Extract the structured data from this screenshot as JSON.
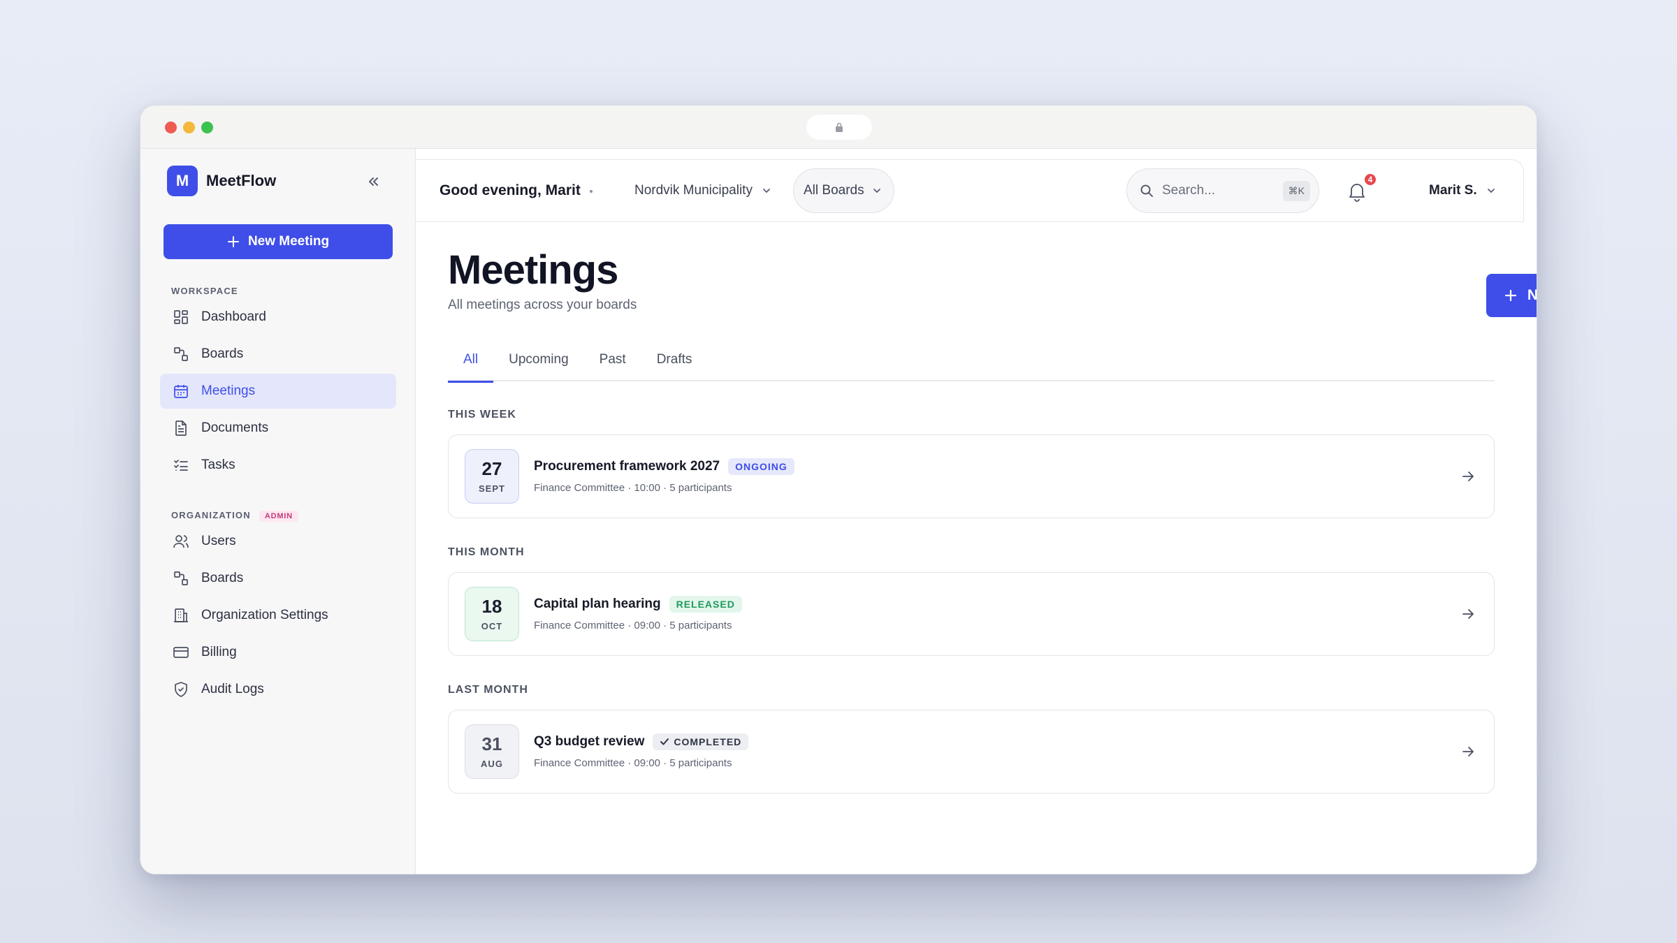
{
  "app": {
    "name": "MeetFlow",
    "logo_letter": "M"
  },
  "sidebar": {
    "new_meeting_label": "New Meeting",
    "workspace_label": "WORKSPACE",
    "workspace_items": [
      {
        "label": "Dashboard",
        "icon": "grid-icon"
      },
      {
        "label": "Boards",
        "icon": "boards-icon"
      },
      {
        "label": "Meetings",
        "icon": "calendar-icon",
        "active": true
      },
      {
        "label": "Documents",
        "icon": "document-icon"
      },
      {
        "label": "Tasks",
        "icon": "checklist-icon"
      }
    ],
    "organization_label": "ORGANIZATION",
    "admin_badge": "ADMIN",
    "organization_items": [
      {
        "label": "Users",
        "icon": "users-icon"
      },
      {
        "label": "Boards",
        "icon": "boards-icon"
      },
      {
        "label": "Organization Settings",
        "icon": "building-icon"
      },
      {
        "label": "Billing",
        "icon": "card-icon"
      },
      {
        "label": "Audit Logs",
        "icon": "shield-icon"
      }
    ]
  },
  "topbar": {
    "greeting": "Good evening, Marit",
    "organization": "Nordvik Municipality",
    "boards_filter": "All Boards",
    "search_placeholder": "Search...",
    "search_shortcut": "⌘K",
    "notification_count": "4",
    "user_name": "Marit S."
  },
  "page": {
    "title": "Meetings",
    "subtitle": "All meetings across your boards",
    "new_meeting_label": "New Meeting",
    "tabs": [
      "All",
      "Upcoming",
      "Past",
      "Drafts"
    ],
    "active_tab": "All"
  },
  "groups": [
    {
      "label": "THIS WEEK",
      "meeting": {
        "day": "27",
        "month": "SEPT",
        "title": "Procurement framework 2027",
        "status": "ONGOING",
        "meta": "Finance Committee · 10:00 · 5 participants"
      }
    },
    {
      "label": "THIS MONTH",
      "meeting": {
        "day": "18",
        "month": "OCT",
        "title": "Capital plan hearing",
        "status": "RELEASED",
        "meta": "Finance Committee · 09:00 · 5 participants"
      }
    },
    {
      "label": "LAST MONTH",
      "meeting": {
        "day": "31",
        "month": "AUG",
        "title": "Q3 budget review",
        "status": "COMPLETED",
        "meta": "Finance Committee · 09:00 · 5 participants"
      }
    }
  ],
  "colors": {
    "accent": "#3f4ee8",
    "ongoing_bg": "#e6e8fb",
    "ongoing_fg": "#3f4ee8",
    "released_bg": "#e3f6ec",
    "released_fg": "#1f9b5d",
    "completed_bg": "#eceef2",
    "completed_fg": "#2f3444"
  }
}
